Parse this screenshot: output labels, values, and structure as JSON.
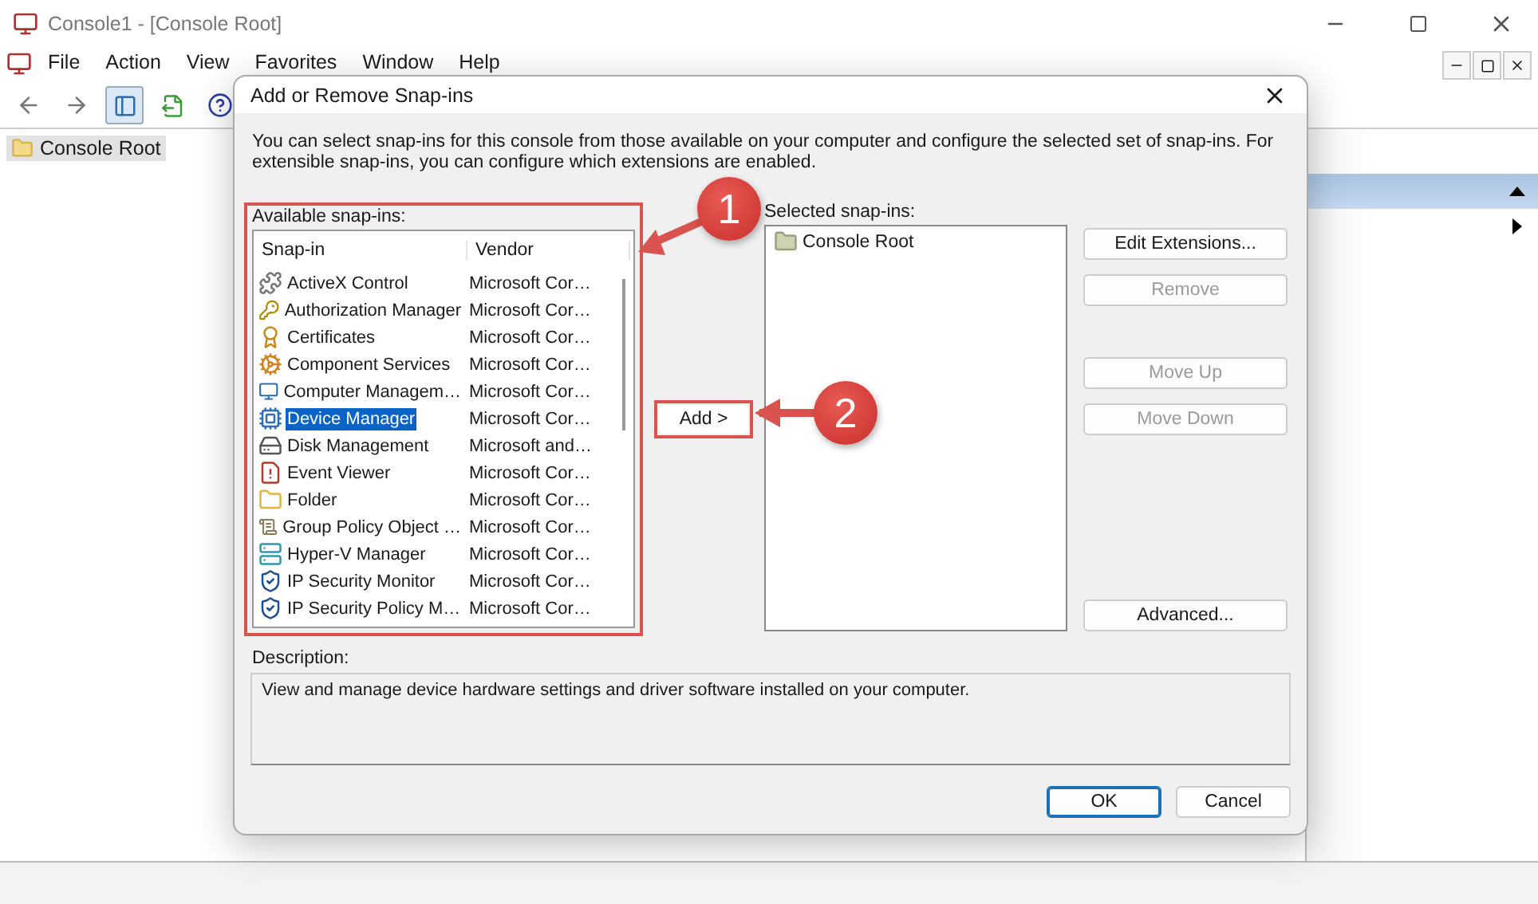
{
  "console": {
    "title": "Console1 - [Console Root]",
    "menu": [
      "File",
      "Action",
      "View",
      "Favorites",
      "Window",
      "Help"
    ],
    "tree": [
      {
        "label": "Console Root",
        "selected": true
      }
    ]
  },
  "dialog": {
    "title": "Add or Remove Snap-ins",
    "intro": "You can select snap-ins for this console from those available on your computer and configure the selected set of snap-ins. For extensible snap-ins, you can configure which extensions are enabled.",
    "available": {
      "label": "Available snap-ins:",
      "columns": [
        "Snap-in",
        "Vendor"
      ],
      "rows": [
        {
          "name": "ActiveX Control",
          "vendor": "Microsoft Cor…",
          "selected": false
        },
        {
          "name": "Authorization Manager",
          "vendor": "Microsoft Cor…",
          "selected": false
        },
        {
          "name": "Certificates",
          "vendor": "Microsoft Cor…",
          "selected": false
        },
        {
          "name": "Component Services",
          "vendor": "Microsoft Cor…",
          "selected": false
        },
        {
          "name": "Computer Managem…",
          "vendor": "Microsoft Cor…",
          "selected": false
        },
        {
          "name": "Device Manager",
          "vendor": "Microsoft Cor…",
          "selected": true
        },
        {
          "name": "Disk Management",
          "vendor": "Microsoft and…",
          "selected": false
        },
        {
          "name": "Event Viewer",
          "vendor": "Microsoft Cor…",
          "selected": false
        },
        {
          "name": "Folder",
          "vendor": "Microsoft Cor…",
          "selected": false
        },
        {
          "name": "Group Policy Object …",
          "vendor": "Microsoft Cor…",
          "selected": false
        },
        {
          "name": "Hyper-V Manager",
          "vendor": "Microsoft Cor…",
          "selected": false
        },
        {
          "name": "IP Security Monitor",
          "vendor": "Microsoft Cor…",
          "selected": false
        },
        {
          "name": "IP Security Policy M…",
          "vendor": "Microsoft Cor…",
          "selected": false
        }
      ]
    },
    "add_button": "Add >",
    "selected": {
      "label": "Selected snap-ins:",
      "items": [
        "Console Root"
      ]
    },
    "side_buttons": [
      {
        "label": "Edit Extensions...",
        "disabled": false
      },
      {
        "label": "Remove",
        "disabled": true
      },
      {
        "label": "Move Up",
        "disabled": true
      },
      {
        "label": "Move Down",
        "disabled": true
      },
      {
        "label": "Advanced...",
        "disabled": false
      }
    ],
    "description": {
      "label": "Description:",
      "text": "View and manage device hardware settings and driver software installed on your computer."
    },
    "buttons": [
      {
        "label": "OK",
        "default": true
      },
      {
        "label": "Cancel",
        "default": false
      }
    ]
  },
  "annotations": [
    {
      "number": "1"
    },
    {
      "number": "2"
    }
  ]
}
